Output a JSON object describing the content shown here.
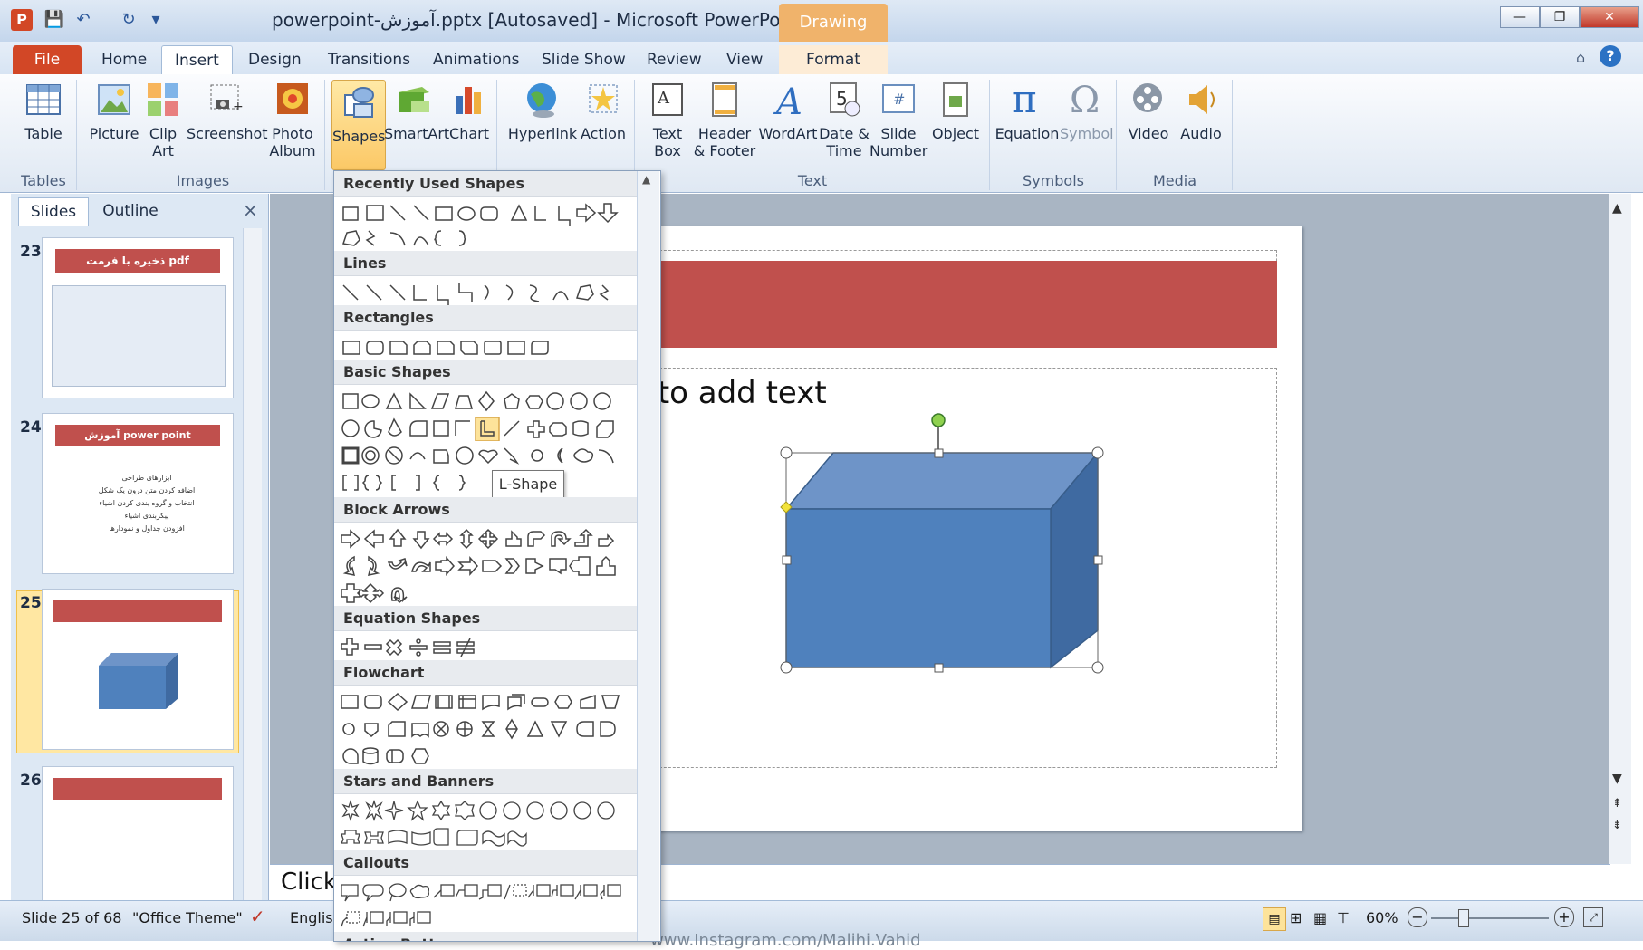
{
  "titlebar": {
    "window_title": "powerpoint-آموزش.pptx [Autosaved] - Microsoft PowerPoint",
    "contextual_group": "Drawing Tools",
    "app_icon_letter": "P"
  },
  "tabs": [
    "File",
    "Home",
    "Insert",
    "Design",
    "Transitions",
    "Animations",
    "Slide Show",
    "Review",
    "View",
    "Format"
  ],
  "ribbon": {
    "buttons": {
      "table": "Table",
      "picture": "Picture",
      "clip_art": "Clip Art",
      "screenshot": "Screenshot",
      "photo_album": "Photo Album",
      "shapes": "Shapes",
      "smartart": "SmartArt",
      "chart": "Chart",
      "hyperlink": "Hyperlink",
      "action": "Action",
      "text_box": "Text Box",
      "header_footer": "Header & Footer",
      "wordart": "WordArt",
      "date_time": "Date & Time",
      "slide_number": "Slide Number",
      "object": "Object",
      "equation": "Equation",
      "symbol": "Symbol",
      "video": "Video",
      "audio": "Audio"
    },
    "groups": {
      "tables": "Tables",
      "images": "Images",
      "text": "Text",
      "symbols": "Symbols",
      "media": "Media"
    }
  },
  "left_panel": {
    "tab_slides": "Slides",
    "tab_outline": "Outline",
    "close_glyph": "×",
    "thumbs": [
      {
        "num": "23",
        "title": "ذخیره با فرمت pdf"
      },
      {
        "num": "24",
        "title": "آموزش power point",
        "lines": [
          "ابزارهای طراحی",
          "اضافه کردن متن درون یک شکل",
          "انتخاب و گروه بندی کردن اشیاء",
          "پیکربندی اشیاء",
          "افزودن جداول و نمودارها"
        ]
      },
      {
        "num": "25",
        "title": ""
      },
      {
        "num": "26",
        "title": ""
      }
    ]
  },
  "slide": {
    "body_placeholder": "Click to add text"
  },
  "notes": {
    "placeholder": "Click t"
  },
  "shapes_gallery": {
    "sections": [
      "Recently Used Shapes",
      "Lines",
      "Rectangles",
      "Basic Shapes",
      "Block Arrows",
      "Equation Shapes",
      "Flowchart",
      "Stars and Banners",
      "Callouts",
      "Action Buttons"
    ],
    "tooltip": "L-Shape"
  },
  "statusbar": {
    "slide_info": "Slide 25 of 68",
    "theme": "\"Office Theme\"",
    "language": "Englis",
    "zoom": "60%"
  },
  "watermark": "www.Instagram.com/Malihi.Vahid",
  "colors": {
    "accent_red": "#c0504d",
    "shape_blue": "#4f81bd",
    "file_tab": "#d24726",
    "drawing_tools": "#f0b36b"
  }
}
